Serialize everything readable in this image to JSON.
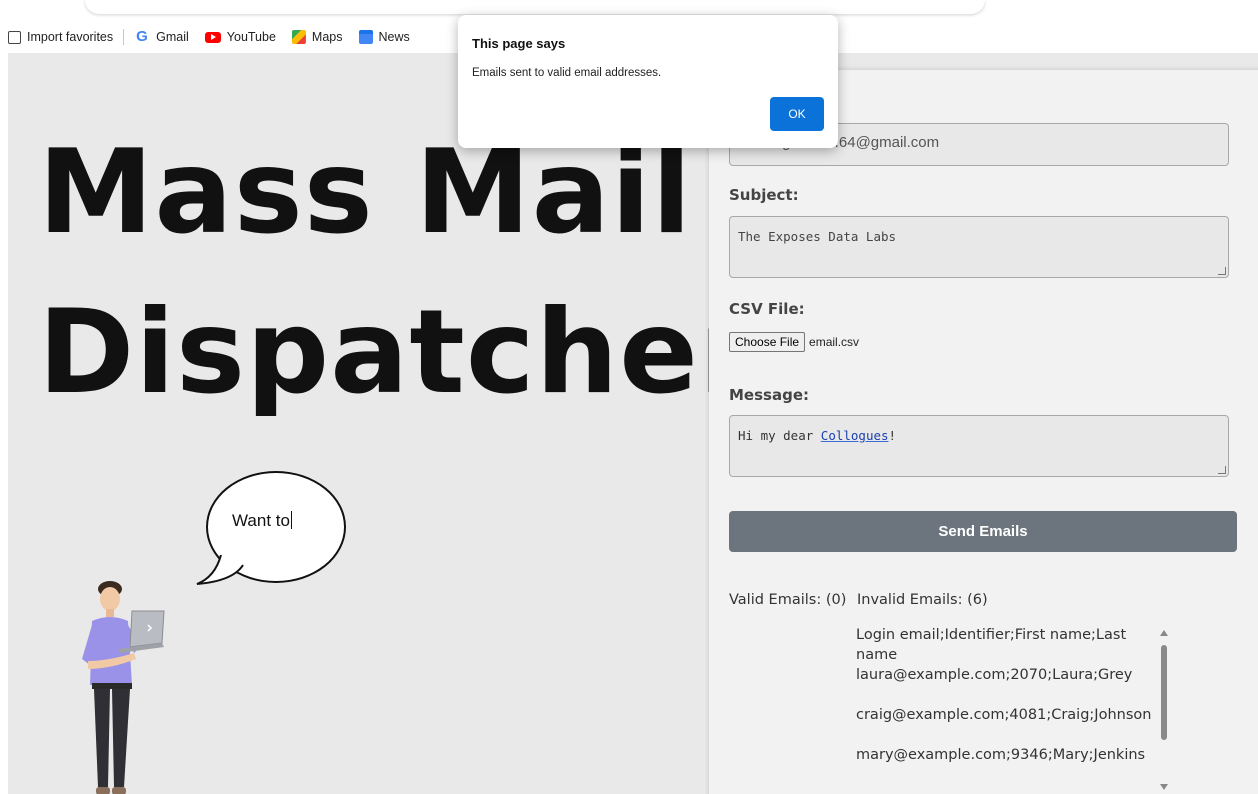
{
  "bookmarks": [
    {
      "label": "Import favorites",
      "icon": "import-icon"
    },
    {
      "label": "Gmail",
      "icon": "google-icon"
    },
    {
      "label": "YouTube",
      "icon": "youtube-icon"
    },
    {
      "label": "Maps",
      "icon": "maps-icon"
    },
    {
      "label": "News",
      "icon": "news-icon"
    }
  ],
  "hero": {
    "line1": "Mass Mail",
    "line2": "Dispatcher"
  },
  "bubble": {
    "text": "Want to"
  },
  "form": {
    "email_value": "zncomgowdu...64@gmail.com",
    "email_visible": "64@gmail.com",
    "subject_label": "Subject:",
    "subject_value": "The Exposes Data Labs",
    "csv_label": "CSV File:",
    "choose_file_label": "Choose File",
    "file_name": "email.csv",
    "message_label": "Message:",
    "message_prefix": "Hi my dear ",
    "message_misspelled": "Collogues",
    "message_suffix": "!",
    "send_label": "Send Emails",
    "valid_label": "Valid Emails: (0)",
    "invalid_label": "Invalid Emails: (6)",
    "invalid_emails": [
      "Login email;Identifier;First name;Last name",
      "laura@example.com;2070;Laura;Grey",
      "craig@example.com;4081;Craig;Johnson",
      "mary@example.com;9346;Mary;Jenkins"
    ]
  },
  "dialog": {
    "title": "This page says",
    "message": "Emails sent to valid email addresses.",
    "ok_label": "OK"
  },
  "colors": {
    "send_button": "#6c757d",
    "ok_button": "#0a72d8",
    "page_bg": "#e9e9e9"
  }
}
